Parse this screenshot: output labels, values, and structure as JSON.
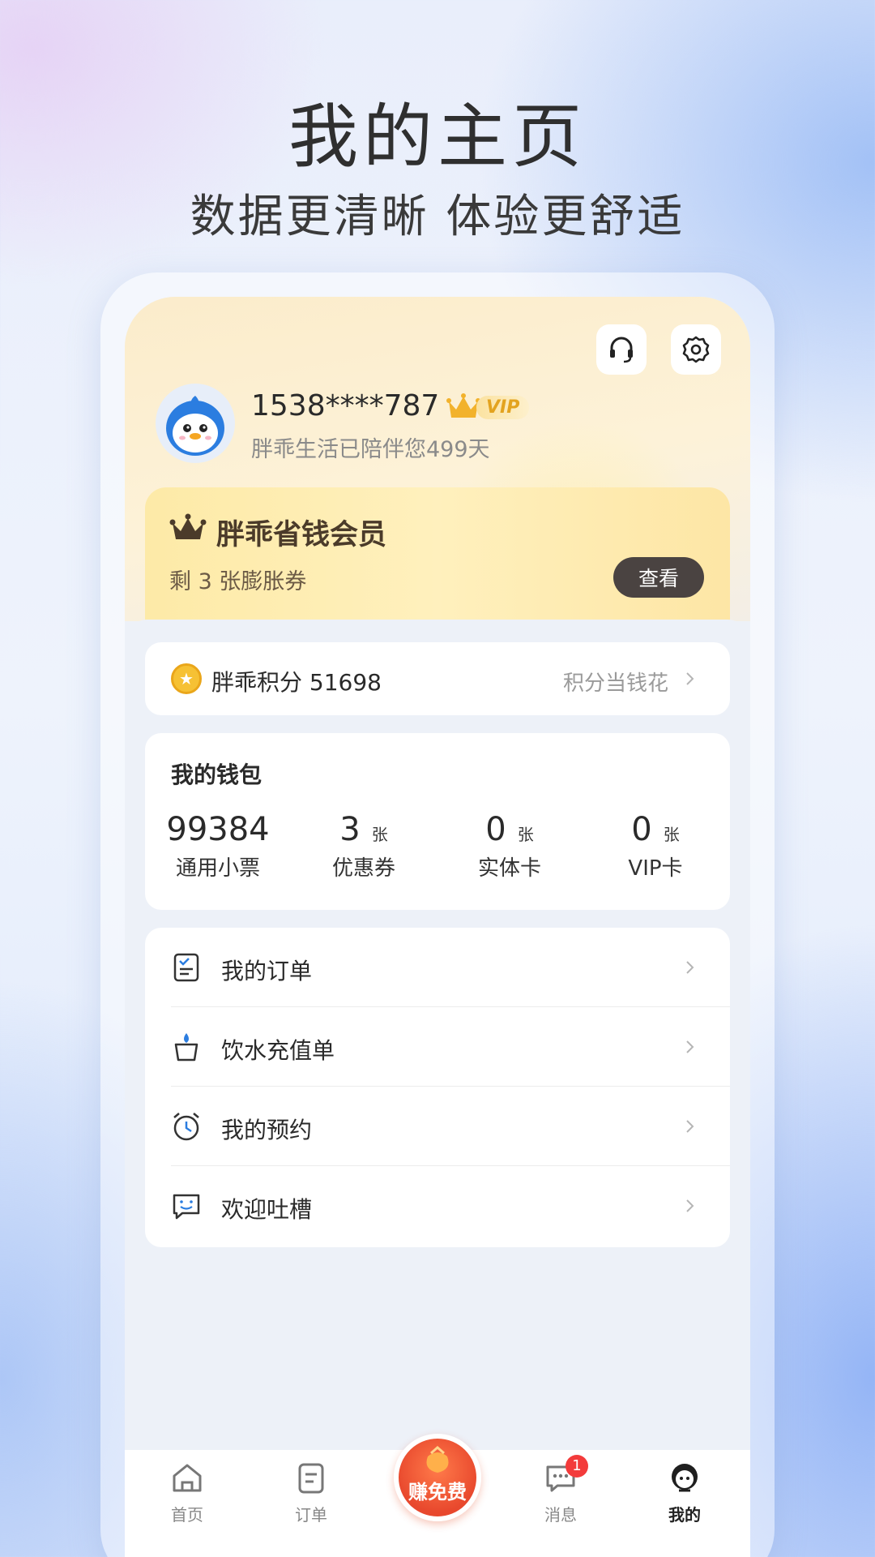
{
  "hero": {
    "title": "我的主页",
    "subtitle": "数据更清晰 体验更舒适"
  },
  "header": {
    "support_icon": "headset-icon",
    "settings_icon": "gear-icon",
    "username": "1538****787",
    "vip_label": "VIP",
    "days_text": "胖乖生活已陪伴您499天"
  },
  "member": {
    "title": "胖乖省钱会员",
    "subtitle": "剩 3 张膨胀券",
    "view_button": "查看"
  },
  "points": {
    "label": "胖乖积分 51698",
    "link": "积分当钱花"
  },
  "wallet": {
    "title": "我的钱包",
    "items": [
      {
        "value": "99384",
        "unit": "",
        "label": "通用小票"
      },
      {
        "value": "3",
        "unit": "张",
        "label": "优惠券"
      },
      {
        "value": "0",
        "unit": "张",
        "label": "实体卡"
      },
      {
        "value": "0",
        "unit": "张",
        "label": "VIP卡"
      }
    ]
  },
  "menu": [
    {
      "label": "我的订单",
      "icon": "clipboard-check-icon"
    },
    {
      "label": "饮水充值单",
      "icon": "water-cup-icon"
    },
    {
      "label": "我的预约",
      "icon": "alarm-clock-icon"
    },
    {
      "label": "欢迎吐槽",
      "icon": "feedback-chat-icon"
    }
  ],
  "tabbar": {
    "home": "首页",
    "orders": "订单",
    "earn": "赚免费",
    "messages": "消息",
    "messages_badge": "1",
    "mine": "我的"
  },
  "colors": {
    "accent_gold": "#e3a31f",
    "earn_red": "#e8482d",
    "badge_red": "#f33b3b"
  }
}
